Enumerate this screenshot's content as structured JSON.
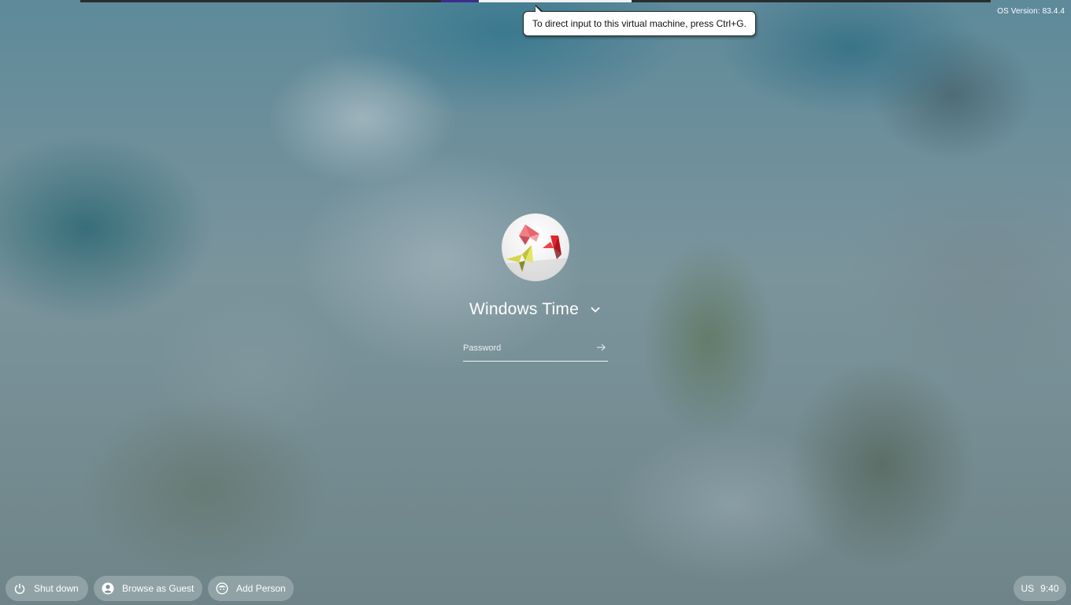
{
  "vm_tooltip": {
    "text": "To direct input to this virtual machine, press Ctrl+G."
  },
  "os_version": "OS Version: 83.4.4",
  "user": {
    "name": "Windows Time",
    "avatar_icon": "origami-birds-avatar",
    "menu_icon": "chevron-down-icon"
  },
  "password": {
    "placeholder": "Password",
    "value": "",
    "submit_icon": "arrow-right-icon"
  },
  "shelf": {
    "shutdown_label": "Shut down",
    "guest_label": "Browse as Guest",
    "add_person_label": "Add Person"
  },
  "status": {
    "keyboard_layout": "US",
    "time": "9:40"
  }
}
